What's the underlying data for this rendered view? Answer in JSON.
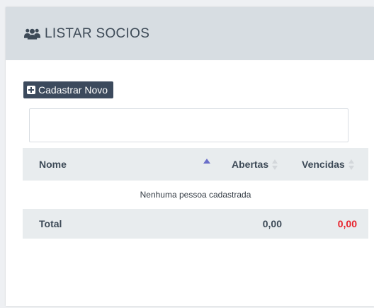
{
  "panel": {
    "title": "LISTAR SOCIOS",
    "icon": "users-icon"
  },
  "toolbar": {
    "new_button_label": "Cadastrar Novo",
    "new_button_icon": "plus-square-icon"
  },
  "search": {
    "value": "",
    "placeholder": ""
  },
  "table": {
    "columns": [
      {
        "label": "Nome",
        "sort": "ascending"
      },
      {
        "label": "Abertas",
        "sort": "none"
      },
      {
        "label": "Vencidas",
        "sort": "none"
      }
    ],
    "empty_message": "Nenhuma pessoa cadastrada",
    "footer": {
      "label": "Total",
      "abertas": "0,00",
      "vencidas": "0,00"
    }
  },
  "colors": {
    "header_bg": "#d7dde2",
    "button_bg": "#3c4a5d",
    "sort_active": "#6a6fc9",
    "overdue_red": "#e8222b"
  }
}
